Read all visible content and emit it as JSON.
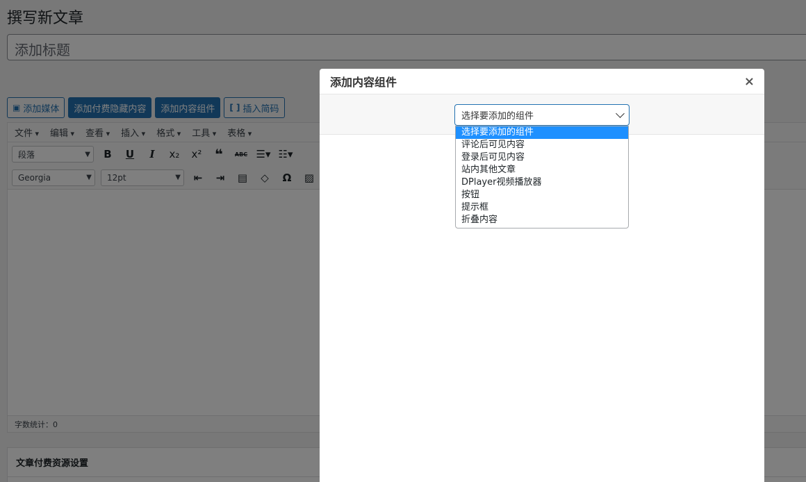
{
  "page": {
    "title": "撰写新文章",
    "title_placeholder": "添加标题"
  },
  "media_buttons": {
    "add_media": "添加媒体",
    "add_paid_hidden": "添加付费隐藏内容",
    "add_component": "添加内容组件",
    "insert_shortcode": "插入简码"
  },
  "editor": {
    "menu": [
      "文件",
      "编辑",
      "查看",
      "插入",
      "格式",
      "工具",
      "表格"
    ],
    "format_select": "段落",
    "font_select": "Georgia",
    "size_select": "12pt",
    "word_count": "字数统计：0"
  },
  "meta_box": {
    "title": "文章付费资源设置"
  },
  "modal": {
    "title": "添加内容组件",
    "close": "×",
    "select_value": "选择要添加的组件",
    "options": [
      "选择要添加的组件",
      "评论后可见内容",
      "登录后可见内容",
      "站内其他文章",
      "DPlayer视频播放器",
      "按钮",
      "提示框",
      "折叠内容"
    ]
  },
  "colors": {
    "accent": "#2271b1",
    "highlight": "#1e90ff"
  }
}
